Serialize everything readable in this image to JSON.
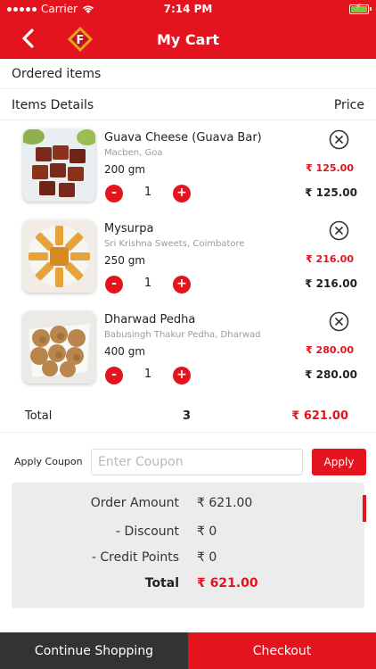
{
  "status_bar": {
    "carrier": "Carrier",
    "time": "7:14 PM"
  },
  "header": {
    "title": "My Cart",
    "logo_letter": "F"
  },
  "sections": {
    "ordered_items": "Ordered items",
    "items_details": "Items Details",
    "price": "Price"
  },
  "items": [
    {
      "name": "Guava Cheese (Guava Bar)",
      "shop": "Macben, Goa",
      "weight": "200 gm",
      "qty": "1",
      "unit_price": "₹ 125.00",
      "line_price": "₹ 125.00"
    },
    {
      "name": "Mysurpa",
      "shop": "Sri Krishna Sweets, Coimbatore",
      "weight": "250 gm",
      "qty": "1",
      "unit_price": "₹ 216.00",
      "line_price": "₹ 216.00"
    },
    {
      "name": "Dharwad Pedha",
      "shop": "Babusingh Thakur Pedha, Dharwad",
      "weight": "400 gm",
      "qty": "1",
      "unit_price": "₹ 280.00",
      "line_price": "₹ 280.00"
    }
  ],
  "qty_controls": {
    "minus": "-",
    "plus": "+"
  },
  "total": {
    "label": "Total",
    "count": "3",
    "amount": "₹ 621.00"
  },
  "coupon": {
    "label": "Apply Coupon",
    "placeholder": "Enter Coupon",
    "value": "",
    "button": "Apply"
  },
  "summary": {
    "order_amount_label": "Order Amount",
    "order_amount": "₹ 621.00",
    "discount_label": "- Discount",
    "discount": "₹ 0",
    "credit_label": "- Credit Points",
    "credit": "₹ 0",
    "total_label": "Total",
    "total": "₹ 621.00"
  },
  "footer": {
    "continue": "Continue Shopping",
    "checkout": "Checkout"
  },
  "colors": {
    "brand": "#e4141f",
    "dark": "#333333",
    "summary_bg": "#ececec"
  }
}
